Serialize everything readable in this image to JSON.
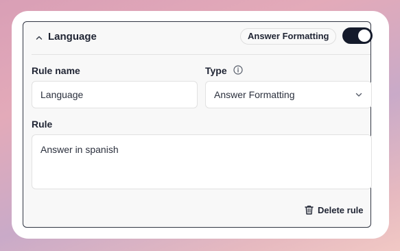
{
  "rule": {
    "title": "Language",
    "type_badge": "Answer Formatting",
    "enabled": true,
    "name_label": "Rule name",
    "name_value": "Language",
    "type_label": "Type",
    "type_value": "Answer Formatting",
    "rule_label": "Rule",
    "rule_value": "Answer in spanish",
    "delete_label": "Delete rule"
  },
  "icons": {
    "collapse": "chevron-up-icon",
    "info": "info-icon",
    "select": "chevron-down-icon",
    "delete": "trash-icon"
  },
  "colors": {
    "toggle_on": "#141a2b",
    "panel_border": "#2f3441"
  }
}
